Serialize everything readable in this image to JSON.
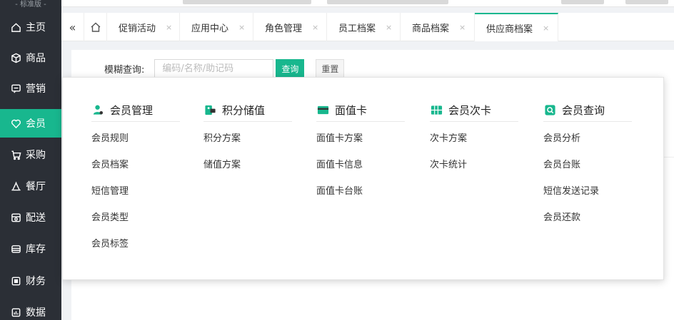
{
  "sidebar": {
    "edition": "- 标准版 -",
    "items": [
      {
        "label": "主页",
        "icon": "home-icon"
      },
      {
        "label": "商品",
        "icon": "cube-icon"
      },
      {
        "label": "营销",
        "icon": "chat-icon"
      },
      {
        "label": "会员",
        "icon": "heart-icon",
        "active": true
      },
      {
        "label": "采购",
        "icon": "cart-icon"
      },
      {
        "label": "餐厅",
        "icon": "tent-icon"
      },
      {
        "label": "配送",
        "icon": "truck-icon"
      },
      {
        "label": "库存",
        "icon": "box-icon"
      },
      {
        "label": "财务",
        "icon": "wallet-icon"
      },
      {
        "label": "数据",
        "icon": "chart-icon"
      }
    ]
  },
  "tabbar": {
    "collapse_glyph": "«",
    "tabs": [
      {
        "label": "促销活动"
      },
      {
        "label": "应用中心"
      },
      {
        "label": "角色管理"
      },
      {
        "label": "员工档案"
      },
      {
        "label": "商品档案"
      },
      {
        "label": "供应商档案",
        "active": true
      }
    ],
    "close_glyph": "×"
  },
  "search": {
    "label": "模糊查询:",
    "placeholder": "编码/名称/助记码",
    "query_label": "查询",
    "reset_label": "重置"
  },
  "mega_menu": {
    "columns": [
      {
        "title": "会员管理",
        "icon": "member-icon",
        "icon_color": "#18b78e",
        "items": [
          "会员规则",
          "会员档案",
          "短信管理",
          "会员类型",
          "会员标签"
        ]
      },
      {
        "title": "积分储值",
        "icon": "points-icon",
        "icon_color": "#18b78e",
        "items": [
          "积分方案",
          "储值方案"
        ]
      },
      {
        "title": "面值卡",
        "icon": "card-icon",
        "icon_color": "#18b78e",
        "items": [
          "面值卡方案",
          "面值卡信息",
          "面值卡台账"
        ]
      },
      {
        "title": "会员次卡",
        "icon": "ticket-icon",
        "icon_color": "#18b78e",
        "items": [
          "次卡方案",
          "次卡统计"
        ]
      },
      {
        "title": "会员查询",
        "icon": "query-icon",
        "icon_color": "#18b78e",
        "items": [
          "会员分析",
          "会员台账",
          "短信发送记录",
          "会员还款"
        ]
      }
    ]
  }
}
